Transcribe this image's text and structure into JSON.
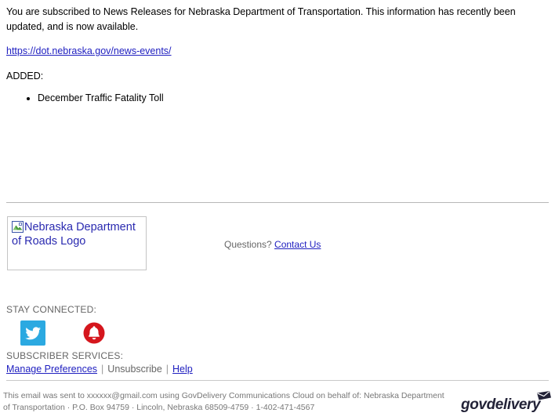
{
  "message": {
    "intro": "You are subscribed to News Releases for Nebraska Department of Transportation. This information has recently been updated, and is now available.",
    "link_text": "https://dot.nebraska.gov/news-events/",
    "added_label": "ADDED:",
    "added_items": [
      "December Traffic Fatality Toll"
    ]
  },
  "footer": {
    "logo_alt": "Nebraska Department of Roads Logo",
    "questions_label": "Questions?",
    "contact_link": "Contact Us",
    "stay_connected_label": "STAY CONNECTED:",
    "social": [
      {
        "name": "twitter-icon",
        "label": "Twitter"
      },
      {
        "name": "bell-icon",
        "label": "Notifications"
      }
    ],
    "subscriber_services_label": "SUBSCRIBER SERVICES:",
    "manage_preferences": "Manage Preferences",
    "separator_1": "|",
    "unsubscribe": "Unsubscribe",
    "separator_2": "|",
    "help": "Help",
    "disclaimer": "This email was sent to xxxxxx@gmail.com using GovDelivery Communications Cloud on behalf of: Nebraska Department of Transportation · P.O. Box 94759 · Lincoln, Nebraska 68509-4759 · 1-402-471-4567",
    "govdelivery_wordmark": "govdelivery"
  },
  "colors": {
    "link": "#2020c0",
    "muted_text": "#666666",
    "twitter_blue": "#2ba9e1",
    "bell_red": "#d5161d",
    "govdelivery_navy": "#232338",
    "rule": "#b8b8b8"
  }
}
